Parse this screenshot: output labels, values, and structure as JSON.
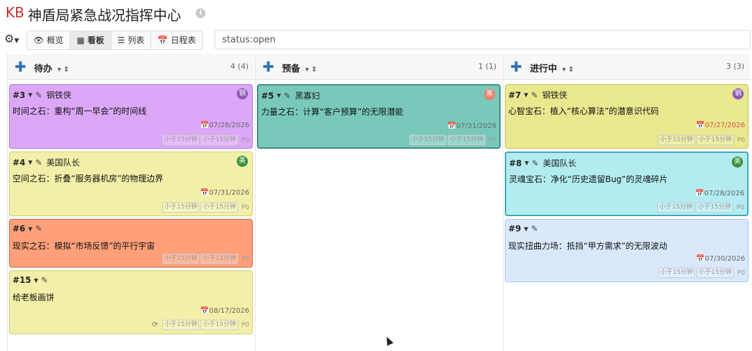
{
  "header": {
    "logo": "KB",
    "title": "神盾局紧急战况指挥中心",
    "info_icon": "info-icon"
  },
  "toolbar": {
    "gear_icon": "⚙",
    "views": [
      {
        "icon": "👁",
        "label": "概览",
        "active": false
      },
      {
        "icon": "▦",
        "label": "看板",
        "active": true
      },
      {
        "icon": "☰",
        "label": "列表",
        "active": false
      },
      {
        "icon": "📅",
        "label": "日程表",
        "active": false
      }
    ],
    "search_value": "status:open"
  },
  "columns": [
    {
      "title": "待办",
      "count": "4 (4)"
    },
    {
      "title": "预备",
      "count": "1 (1)"
    },
    {
      "title": "进行中",
      "count": "3 (3)"
    }
  ],
  "tags": {
    "t1": "小于15分钟",
    "t2": "小于15分钟",
    "priority": "P0"
  },
  "colors": {
    "purple": "#dca7f7",
    "yellow": "#f2f0a8",
    "red": "#ffa07a",
    "teal": "#79c9bb",
    "lime": "#e8e88e",
    "cyan": "#b2ecf0",
    "lightblue": "#d9e9fb"
  },
  "cards": {
    "c3": {
      "num": "#3",
      "owner": "钢铁侠",
      "badge": "钢",
      "title": "时间之石：重构“周一早会”的时间线",
      "date": "07/28/2026"
    },
    "c4": {
      "num": "#4",
      "owner": "美国队长",
      "badge": "美",
      "title": "空间之石：折叠“服务器机房”的物理边界",
      "date": "07/31/2026"
    },
    "c6": {
      "num": "#6",
      "owner": "",
      "badge": "",
      "title": "现实之石：模拟“市场反馈”的平行宇宙",
      "date": ""
    },
    "c15": {
      "num": "#15",
      "owner": "",
      "badge": "",
      "title": "给老板画饼",
      "date": "08/17/2026"
    },
    "c5": {
      "num": "#5",
      "owner": "黑寡妇",
      "badge": "黑",
      "title": "力量之石：计算“客户预算”的无限潜能",
      "date": "07/31/2026"
    },
    "c7": {
      "num": "#7",
      "owner": "钢铁侠",
      "badge": "钢",
      "title": "心智宝石：植入“核心算法”的潜意识代码",
      "date": "07/27/2026"
    },
    "c8": {
      "num": "#8",
      "owner": "美国队长",
      "badge": "美",
      "title": "灵魂宝石：净化“历史遗留Bug”的灵魂碎片",
      "date": "07/28/2026"
    },
    "c9": {
      "num": "#9",
      "owner": "",
      "badge": "",
      "title": "现实扭曲力场：抵挡“甲方需求”的无限波动",
      "date": "07/30/2026"
    }
  }
}
